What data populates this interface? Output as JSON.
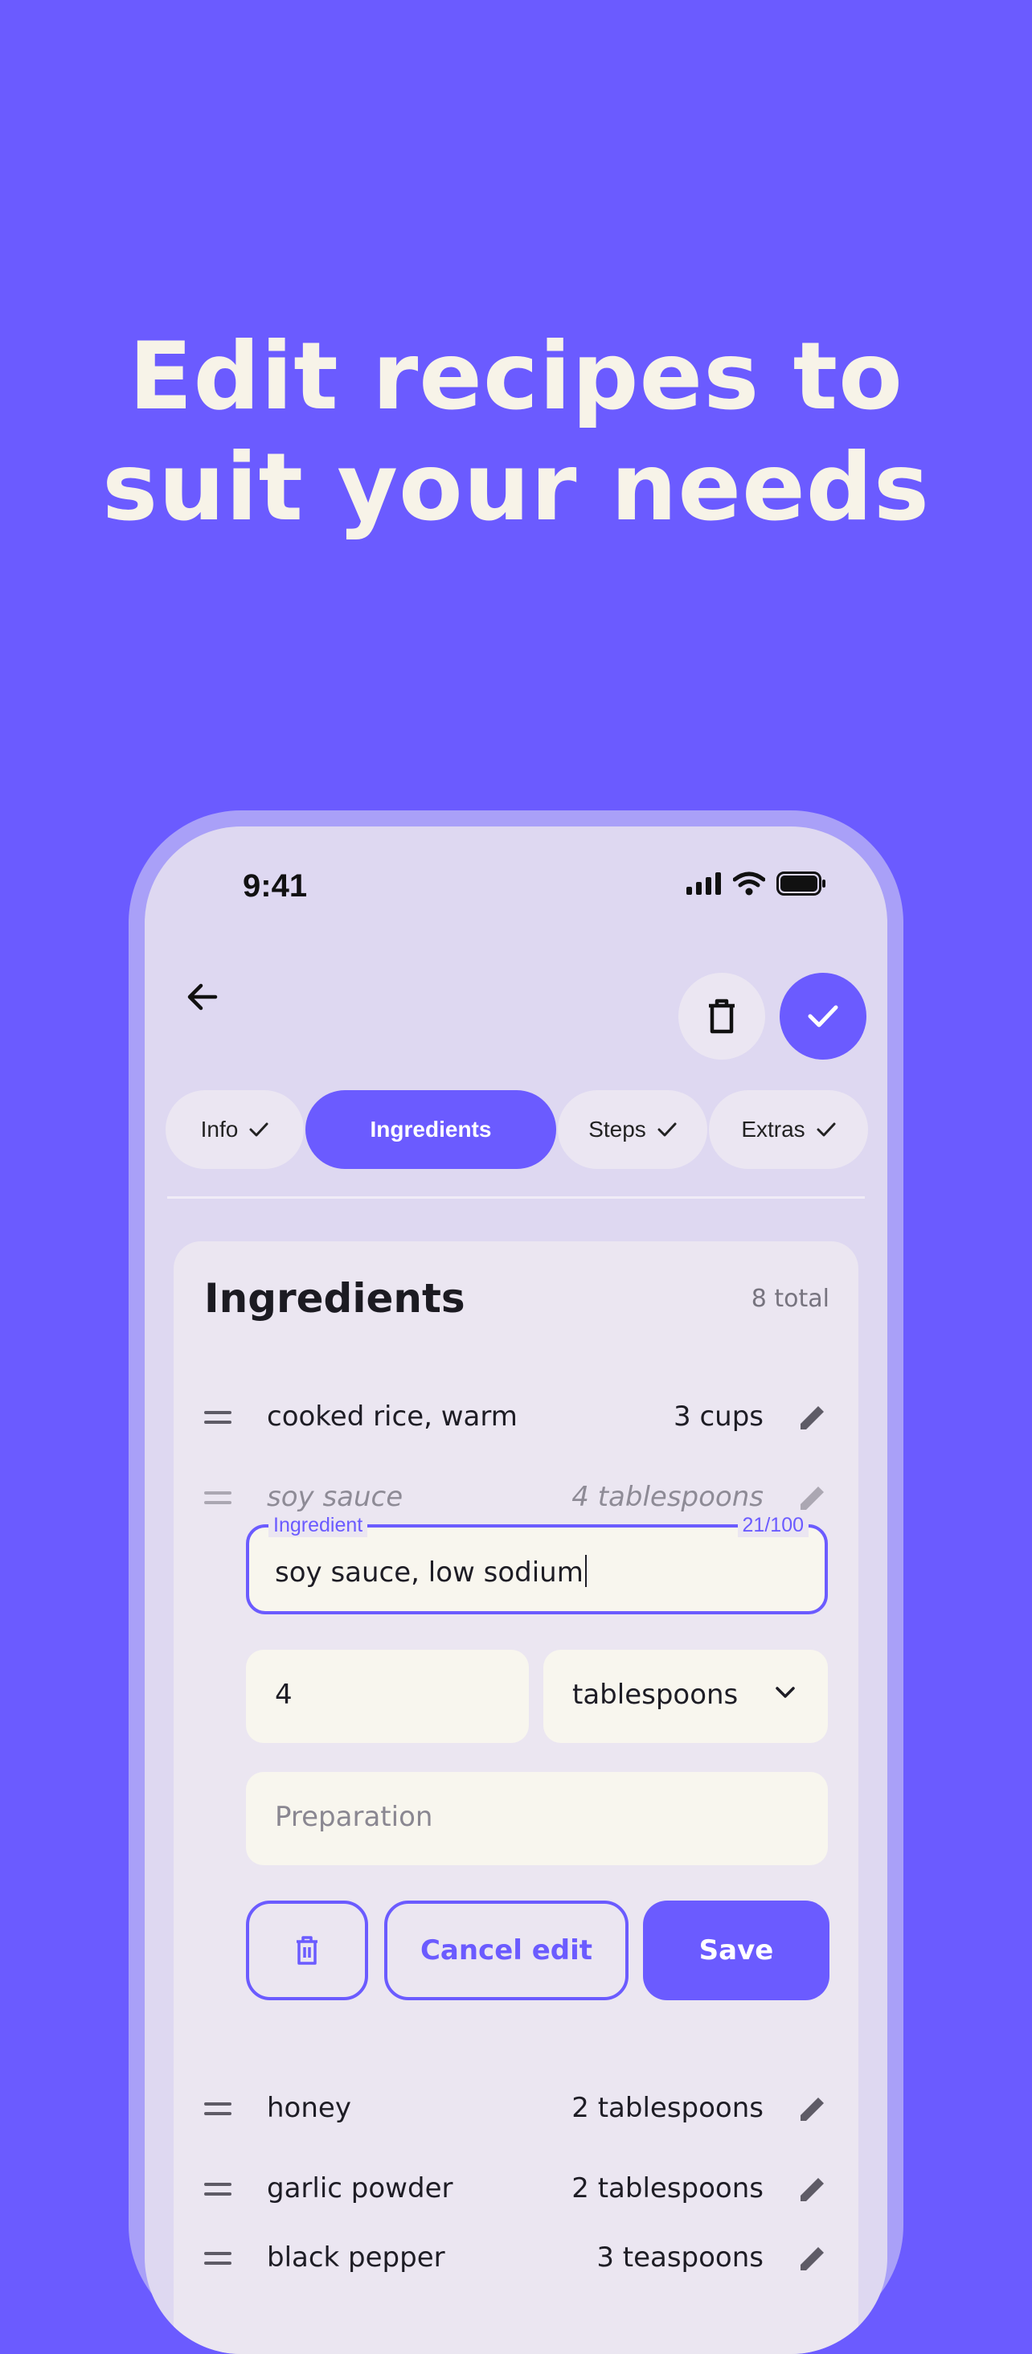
{
  "headline": {
    "line1": "Edit recipes to",
    "line2": "suit your needs"
  },
  "status_bar": {
    "time": "9:41",
    "icons": [
      "signal-icon",
      "wifi-icon",
      "battery-icon"
    ]
  },
  "toolbar": {
    "back_icon": "arrow-left-icon",
    "delete_icon": "trash-icon",
    "confirm_icon": "check-icon"
  },
  "tabs": [
    {
      "label": "Info",
      "completed": true,
      "active": false
    },
    {
      "label": "Ingredients",
      "completed": false,
      "active": true
    },
    {
      "label": "Steps",
      "completed": true,
      "active": false
    },
    {
      "label": "Extras",
      "completed": true,
      "active": false
    }
  ],
  "ingredients_card": {
    "title": "Ingredients",
    "count": "8 total",
    "items": [
      {
        "name": "cooked rice, warm",
        "qty": "3 cups",
        "editing": false
      },
      {
        "name": "soy sauce",
        "qty": "4 tablespoons",
        "editing": true
      },
      {
        "name": "honey",
        "qty": "2 tablespoons",
        "editing": false
      },
      {
        "name": "garlic powder",
        "qty": "2 tablespoons",
        "editing": false
      },
      {
        "name": "black pepper",
        "qty": "3 teaspoons",
        "editing": false
      }
    ],
    "editor": {
      "ingredient_label": "Ingredient",
      "char_counter": "21/100",
      "ingredient_value": "soy sauce, low sodium",
      "quantity_value": "4",
      "unit_value": "tablespoons",
      "preparation_placeholder": "Preparation",
      "cancel_label": "Cancel edit",
      "save_label": "Save"
    }
  },
  "colors": {
    "accent": "#6b5bff",
    "background": "#6b5bff",
    "headline": "#f7f3e8",
    "screen": "#ded8f1",
    "card": "#ebe6f1",
    "field": "#f8f6ee"
  }
}
